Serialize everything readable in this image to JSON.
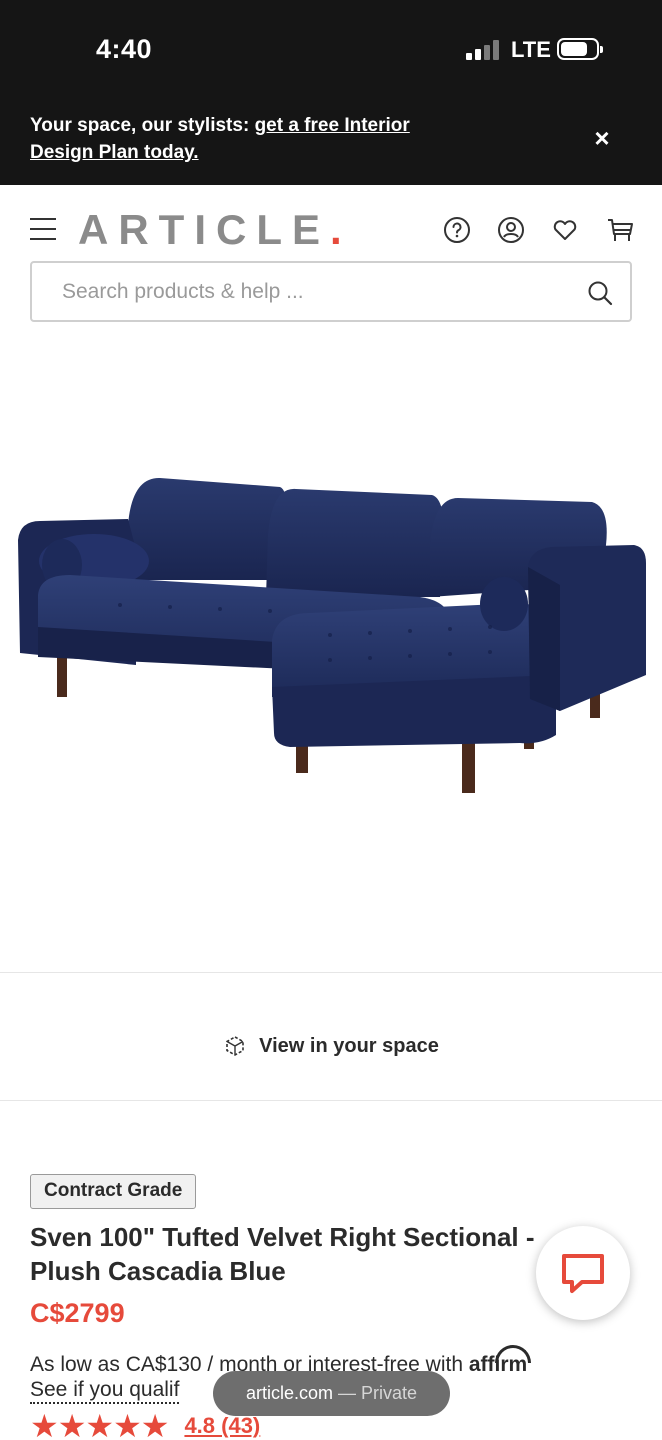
{
  "status_bar": {
    "time": "4:40",
    "network": "LTE"
  },
  "promo": {
    "text": "Your space, our stylists: ",
    "link": "get a free Interior Design Plan today.",
    "close_label": "×"
  },
  "header": {
    "logo": "ARTICLE",
    "logo_dot": "."
  },
  "search": {
    "placeholder": "Search products & help ..."
  },
  "view_in_space": {
    "label": "View in your space"
  },
  "product": {
    "badge": "Contract Grade",
    "title": "Sven 100\" Tufted Velvet Right Sectional - Plush Cascadia Blue",
    "price": "C$2799",
    "financing_text": "As low as CA$130 / month or interest-free with ",
    "financing_brand": "affirm",
    "qualify_link": "See if you qualif",
    "stars": "★★★★★",
    "rating": "4.8 (43)"
  },
  "browser": {
    "domain": "article.com",
    "mode": " — Private"
  },
  "colors": {
    "accent": "#e64a3b",
    "sofa": "#1f2d5a",
    "promo_bg": "#151515"
  }
}
